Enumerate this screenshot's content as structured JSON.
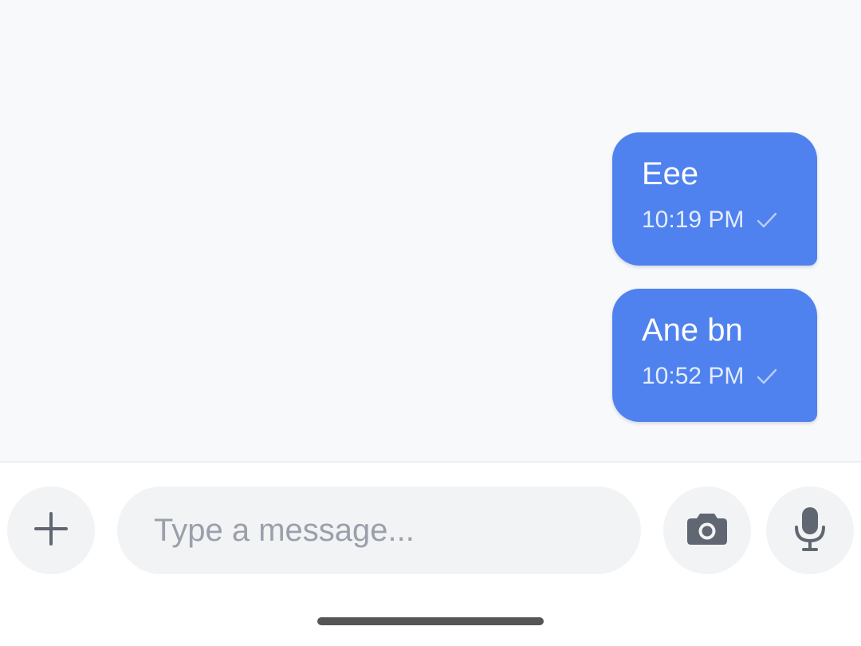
{
  "messages": [
    {
      "text": "Eee",
      "time": "10:19 PM",
      "status_icon": "check-icon"
    },
    {
      "text": "Ane bn",
      "time": "10:52 PM",
      "status_icon": "check-icon"
    }
  ],
  "composer": {
    "placeholder": "Type a message...",
    "value": "",
    "buttons": {
      "add": "plus-icon",
      "camera": "camera-icon",
      "voice": "microphone-icon"
    }
  },
  "colors": {
    "bubble": "#4f82ee",
    "chat_background": "#f8f9fb",
    "button_background": "#f2f3f5",
    "icon": "#606672"
  }
}
